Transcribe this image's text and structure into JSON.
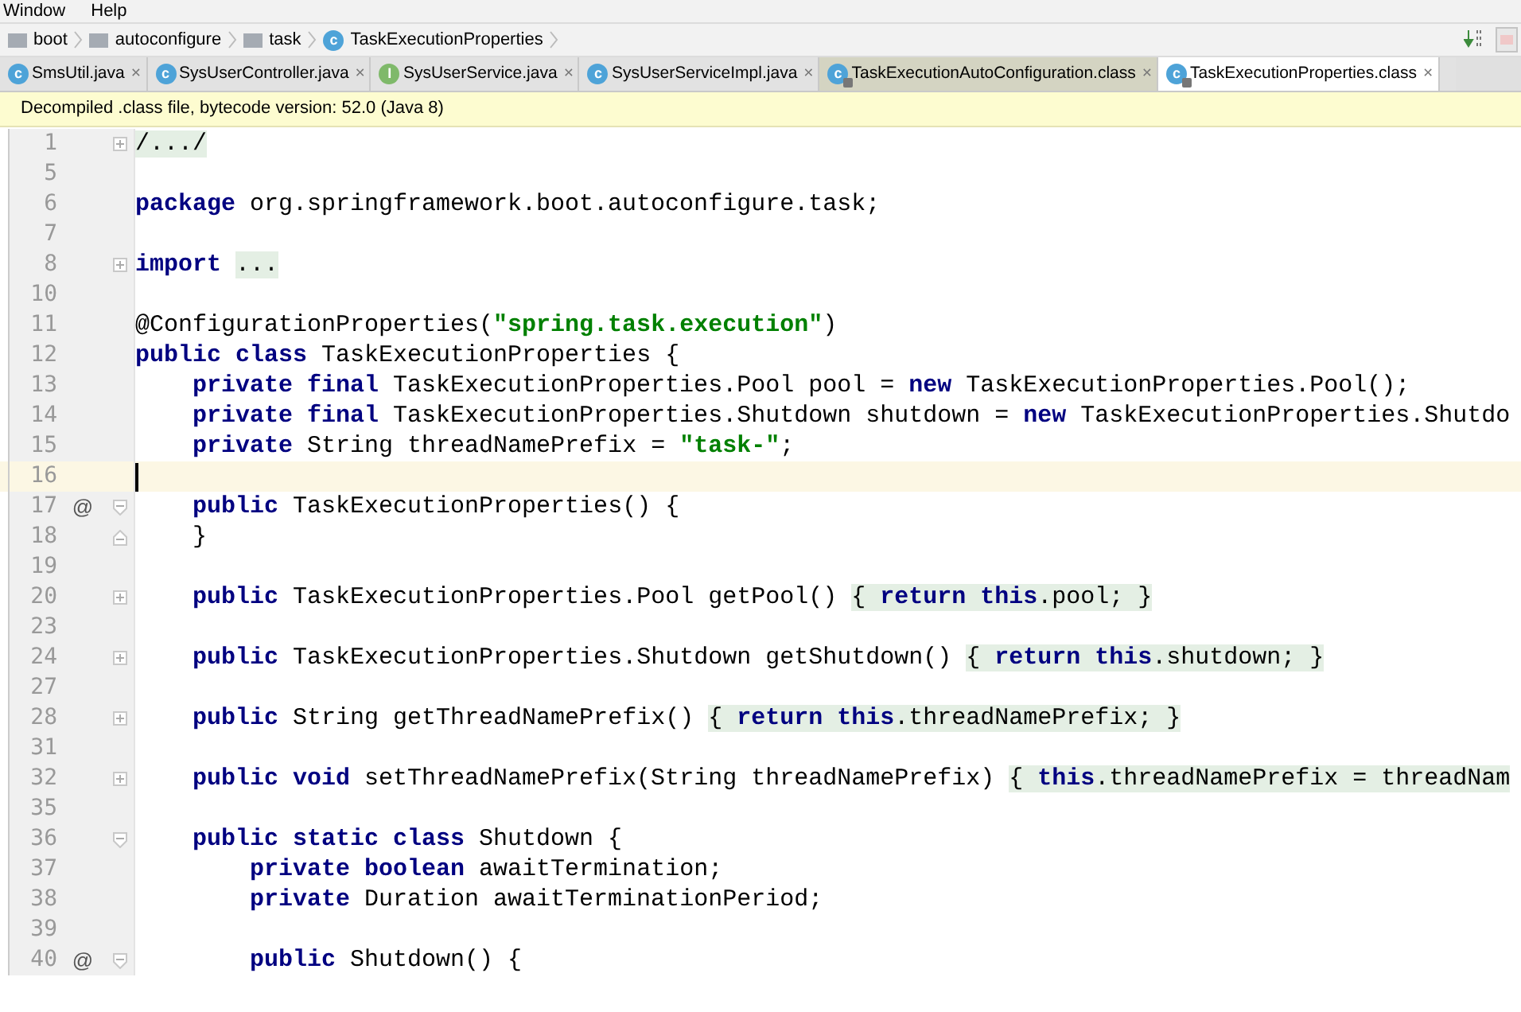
{
  "menu": [
    "Window",
    "Help"
  ],
  "breadcrumb": [
    {
      "label": "boot",
      "kind": "folder"
    },
    {
      "label": "autoconfigure",
      "kind": "folder"
    },
    {
      "label": "task",
      "kind": "folder"
    },
    {
      "label": "TaskExecutionProperties",
      "kind": "class",
      "icon": "c"
    }
  ],
  "tabs": [
    {
      "label": "SmsUtil.java",
      "icon": "c",
      "kind": "class",
      "locked": false,
      "selected": false,
      "close": "×"
    },
    {
      "label": "SysUserController.java",
      "icon": "c",
      "kind": "class",
      "locked": false,
      "selected": false,
      "close": "×"
    },
    {
      "label": "SysUserService.java",
      "icon": "I",
      "kind": "interface",
      "locked": false,
      "selected": false,
      "close": "×"
    },
    {
      "label": "SysUserServiceImpl.java",
      "icon": "c",
      "kind": "class",
      "locked": false,
      "selected": false,
      "close": "×"
    },
    {
      "label": "TaskExecutionAutoConfiguration.class",
      "icon": "c",
      "kind": "class",
      "locked": true,
      "selected": false,
      "close": "×"
    },
    {
      "label": "TaskExecutionProperties.class",
      "icon": "c",
      "kind": "class",
      "locked": true,
      "selected": true,
      "close": "×"
    }
  ],
  "notice": "Decompiled .class file, bytecode version: 52.0 (Java 8)",
  "lines": [
    {
      "number": "1",
      "kind": "expandable",
      "current": false,
      "tokens": [
        {
          "kind": "folded",
          "text": "/.../"
        }
      ]
    },
    {
      "number": "5",
      "current": false
    },
    {
      "number": "6",
      "current": false,
      "tokens": [
        {
          "kind": "kw",
          "text": "package "
        },
        {
          "kind": "plain",
          "text": "org.springframework.boot.autoconfigure.task;"
        }
      ]
    },
    {
      "number": "7",
      "current": false
    },
    {
      "number": "8",
      "kind": "expandable",
      "current": false,
      "tokens": [
        {
          "kind": "kw",
          "text": "import "
        },
        {
          "kind": "folded",
          "text": "..."
        }
      ]
    },
    {
      "number": "10",
      "current": false
    },
    {
      "number": "11",
      "current": false,
      "tokens": [
        {
          "kind": "plain",
          "text": "@ConfigurationProperties("
        },
        {
          "kind": "str",
          "text": "\"spring.task.execution\""
        },
        {
          "kind": "plain",
          "text": ")"
        }
      ]
    },
    {
      "number": "12",
      "current": false,
      "tokens": [
        {
          "kind": "kw",
          "text": "public class "
        },
        {
          "kind": "plain",
          "text": "TaskExecutionProperties {"
        }
      ]
    },
    {
      "number": "13",
      "current": false,
      "tokens": [
        {
          "kind": "kw",
          "text": "    private final "
        },
        {
          "kind": "plain",
          "text": "TaskExecutionProperties.Pool pool = "
        },
        {
          "kind": "kw",
          "text": "new "
        },
        {
          "kind": "plain",
          "text": "TaskExecutionProperties.Pool();"
        }
      ]
    },
    {
      "number": "14",
      "current": false,
      "tokens": [
        {
          "kind": "kw",
          "text": "    private final "
        },
        {
          "kind": "plain",
          "text": "TaskExecutionProperties.Shutdown shutdown = "
        },
        {
          "kind": "kw",
          "text": "new "
        },
        {
          "kind": "plain",
          "text": "TaskExecutionProperties.Shutdo"
        }
      ]
    },
    {
      "number": "15",
      "current": false,
      "tokens": [
        {
          "kind": "kw",
          "text": "    private "
        },
        {
          "kind": "plain",
          "text": "String threadNamePrefix = "
        },
        {
          "kind": "str",
          "text": "\"task-\""
        },
        {
          "kind": "plain",
          "text": ";"
        }
      ]
    },
    {
      "number": "16",
      "current": true
    },
    {
      "number": "17",
      "marker": "@",
      "kind": "collapsible",
      "current": false,
      "tokens": [
        {
          "kind": "kw",
          "text": "    public "
        },
        {
          "kind": "plain",
          "text": "TaskExecutionProperties() {"
        }
      ]
    },
    {
      "number": "18",
      "kind": "fold-end",
      "current": false,
      "tokens": [
        {
          "kind": "plain",
          "text": "    }"
        }
      ]
    },
    {
      "number": "19",
      "current": false
    },
    {
      "number": "20",
      "kind": "expandable",
      "current": false,
      "tokens": [
        {
          "kind": "kw",
          "text": "    public "
        },
        {
          "kind": "plain",
          "text": "TaskExecutionProperties.Pool getPool() "
        },
        {
          "kind": "folded",
          "text": "{ **return this**.pool; }"
        }
      ]
    },
    {
      "number": "23",
      "current": false
    },
    {
      "number": "24",
      "kind": "expandable",
      "current": false,
      "tokens": [
        {
          "kind": "kw",
          "text": "    public "
        },
        {
          "kind": "plain",
          "text": "TaskExecutionProperties.Shutdown getShutdown() "
        },
        {
          "kind": "folded",
          "text": "{ **return this**.shutdown; }"
        }
      ]
    },
    {
      "number": "27",
      "current": false
    },
    {
      "number": "28",
      "kind": "expandable",
      "current": false,
      "tokens": [
        {
          "kind": "kw",
          "text": "    public "
        },
        {
          "kind": "plain",
          "text": "String getThreadNamePrefix() "
        },
        {
          "kind": "folded",
          "text": "{ **return this**.threadNamePrefix; }"
        }
      ]
    },
    {
      "number": "31",
      "current": false
    },
    {
      "number": "32",
      "kind": "expandable",
      "current": false,
      "tokens": [
        {
          "kind": "kw",
          "text": "    public void "
        },
        {
          "kind": "plain",
          "text": "setThreadNamePrefix(String threadNamePrefix) "
        },
        {
          "kind": "folded",
          "text": "{ **this**.threadNamePrefix = threadNam"
        }
      ]
    },
    {
      "number": "35",
      "current": false
    },
    {
      "number": "36",
      "kind": "collapsible",
      "current": false,
      "tokens": [
        {
          "kind": "kw",
          "text": "    public static class "
        },
        {
          "kind": "plain",
          "text": "Shutdown {"
        }
      ]
    },
    {
      "number": "37",
      "current": false,
      "tokens": [
        {
          "kind": "kw",
          "text": "        private boolean "
        },
        {
          "kind": "plain",
          "text": "awaitTermination;"
        }
      ]
    },
    {
      "number": "38",
      "current": false,
      "tokens": [
        {
          "kind": "kw",
          "text": "        private "
        },
        {
          "kind": "plain",
          "text": "Duration awaitTerminationPeriod;"
        }
      ]
    },
    {
      "number": "39",
      "current": false
    },
    {
      "number": "40",
      "marker": "@",
      "kind": "collapsible",
      "current": false,
      "tokens": [
        {
          "kind": "kw",
          "text": "        public "
        },
        {
          "kind": "plain",
          "text": "Shutdown() {"
        }
      ]
    }
  ]
}
